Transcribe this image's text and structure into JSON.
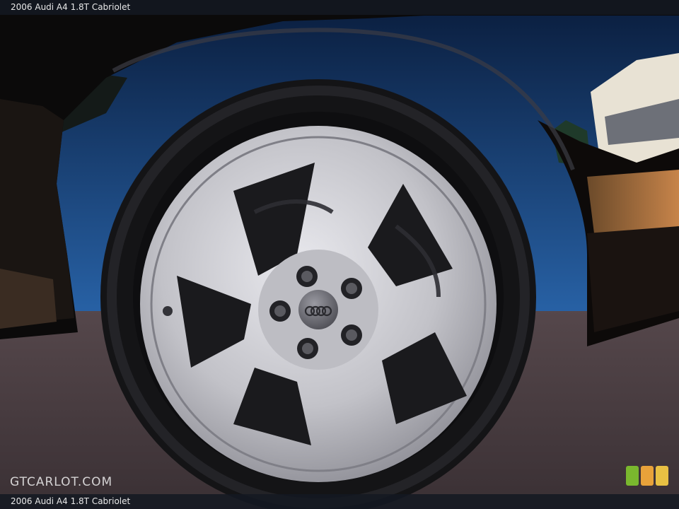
{
  "header": {
    "title": "2006 Audi A4 1.8T Cabriolet"
  },
  "footer": {
    "caption": "2006 Audi A4 1.8T Cabriolet"
  },
  "watermark": {
    "text": "GTCARLOT.COM"
  },
  "rating": {
    "colors": [
      "#7ab82e",
      "#e8a23a",
      "#e8c043"
    ]
  },
  "palette": {
    "sky": "#1e4f8f",
    "body": "#0b0a0a",
    "road": "#4a3e42",
    "rim": "#c9c9ce"
  }
}
